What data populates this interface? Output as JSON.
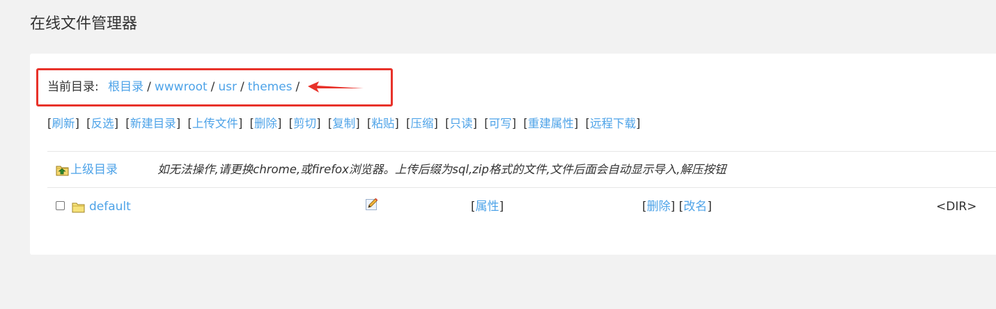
{
  "header": {
    "title": "在线文件管理器"
  },
  "breadcrumb": {
    "label": "当前目录:",
    "items": [
      "根目录",
      "wwwroot",
      "usr",
      "themes"
    ],
    "separator": "/"
  },
  "toolbar": {
    "items": [
      "刷新",
      "反选",
      "新建目录",
      "上传文件",
      "删除",
      "剪切",
      "复制",
      "粘贴",
      "压缩",
      "只读",
      "可写",
      "重建属性",
      "远程下载"
    ]
  },
  "parent_dir": {
    "label": "上级目录",
    "icon": "folder-up-icon"
  },
  "notice": "如无法操作,请更换chrome,或firefox浏览器。上传后缀为sql,zip格式的文件,文件后面会自动显示导入,解压按钮",
  "files": [
    {
      "name": "default",
      "icon": "folder-icon",
      "checked": false,
      "edit_icon": "edit-icon",
      "attr_label": "属性",
      "delete_label": "删除",
      "rename_label": "改名",
      "size": "<DIR>"
    }
  ],
  "colors": {
    "link": "#4ea3e8",
    "highlight_border": "#e8322a",
    "background": "#f2f2f2",
    "panel": "#ffffff"
  }
}
